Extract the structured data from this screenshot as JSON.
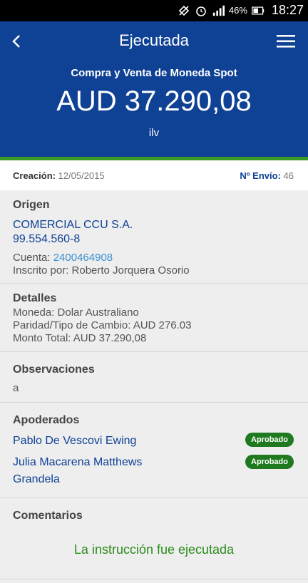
{
  "status": {
    "battery": "46%",
    "time": "18:27"
  },
  "appbar": {
    "title": "Ejecutada"
  },
  "hero": {
    "subtitle": "Compra y Venta de Moneda Spot",
    "amount": "AUD 37.290,08",
    "code": "ilv"
  },
  "meta": {
    "creacion_label": "Creación:",
    "creacion_value": "12/05/2015",
    "envio_label": "Nº Envío:",
    "envio_value": "46"
  },
  "origen": {
    "title": "Origen",
    "company": "COMERCIAL CCU S.A.",
    "rut": "99.554.560-8",
    "cuenta_label": "Cuenta:",
    "cuenta_value": "2400464908",
    "inscrito": "Inscrito por: Roberto Jorquera Osorio"
  },
  "detalles": {
    "title": "Detalles",
    "moneda": "Moneda: Dolar Australiano",
    "paridad": "Paridad/Tipo de Cambio: AUD 276.03",
    "monto": "Monto Total: AUD 37.290,08"
  },
  "observaciones": {
    "title": "Observaciones",
    "value": "a"
  },
  "apoderados": {
    "title": "Apoderados",
    "items": [
      {
        "name_line1": "Pablo De Vescovi Ewing",
        "name_line2": "",
        "status": "Aprobado"
      },
      {
        "name_line1": "Julia Macarena Matthews",
        "name_line2": "Grandela",
        "status": "Aprobado"
      }
    ]
  },
  "comentarios": {
    "title": "Comentarios",
    "message": "La instrucción fue ejecutada"
  },
  "colors": {
    "primary": "#0f4195",
    "accent_green": "#3a9a26",
    "badge_green": "#1f7a1f",
    "link": "#3a8fd0"
  }
}
